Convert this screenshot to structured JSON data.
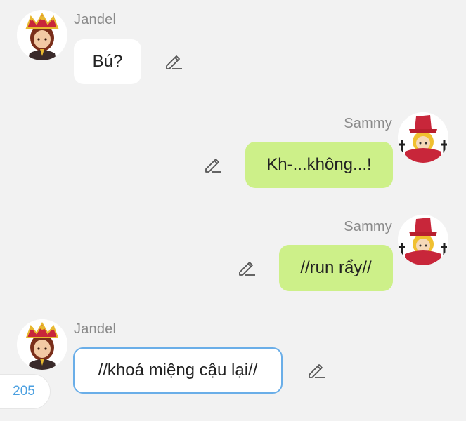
{
  "messages": [
    {
      "sender": "Jandel",
      "text": "Bú?",
      "direction": "incoming"
    },
    {
      "sender": "Sammy",
      "text": "Kh-...không...!",
      "direction": "outgoing"
    },
    {
      "sender": "Sammy",
      "text": "//run rẩy//",
      "direction": "outgoing"
    },
    {
      "sender": "Jandel",
      "text": "//khoá miệng cậu lại//",
      "direction": "incoming",
      "selected": true
    }
  ],
  "badge": {
    "count": "205"
  },
  "icons": {
    "edit": "pencil-edit-icon",
    "avatar_jandel": "crowned-avatar-icon",
    "avatar_sammy": "red-hat-avatar-icon"
  },
  "colors": {
    "background": "#f2f2f2",
    "incoming_bubble": "#ffffff",
    "outgoing_bubble": "#cdf089",
    "selected_border": "#6aaee8",
    "badge_text": "#4a9fe0",
    "name_text": "#8a8a8a"
  }
}
